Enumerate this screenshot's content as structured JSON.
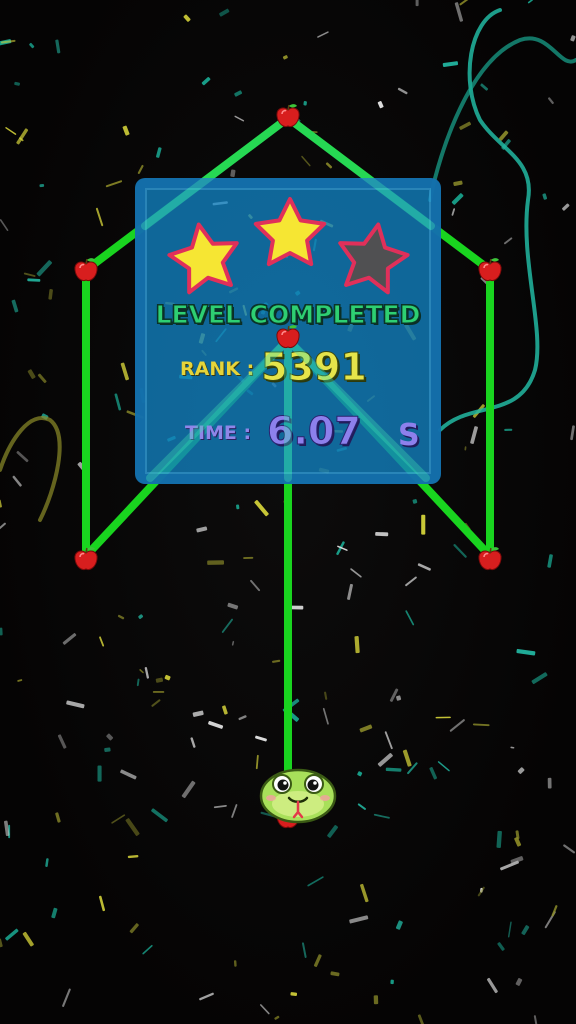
{
  "result": {
    "title": "LEVEL COMPLETED",
    "rank_label": "RANK :",
    "rank_value": "5391",
    "time_label": "TIME :",
    "time_value": "6.07",
    "time_unit": "S",
    "stars_earned": 2,
    "stars_total": 3
  },
  "board": {
    "apples_total": 7,
    "apple_icon": "apple-icon",
    "player_icon": "snake-head-icon"
  },
  "colors": {
    "path": "#19d41f",
    "panel": "#1280be",
    "star_earned": "#f6e633",
    "star_empty": "#505052",
    "star_outline": "#e0305a",
    "apple": "#d81e1e",
    "snake": "#a8e05a"
  }
}
